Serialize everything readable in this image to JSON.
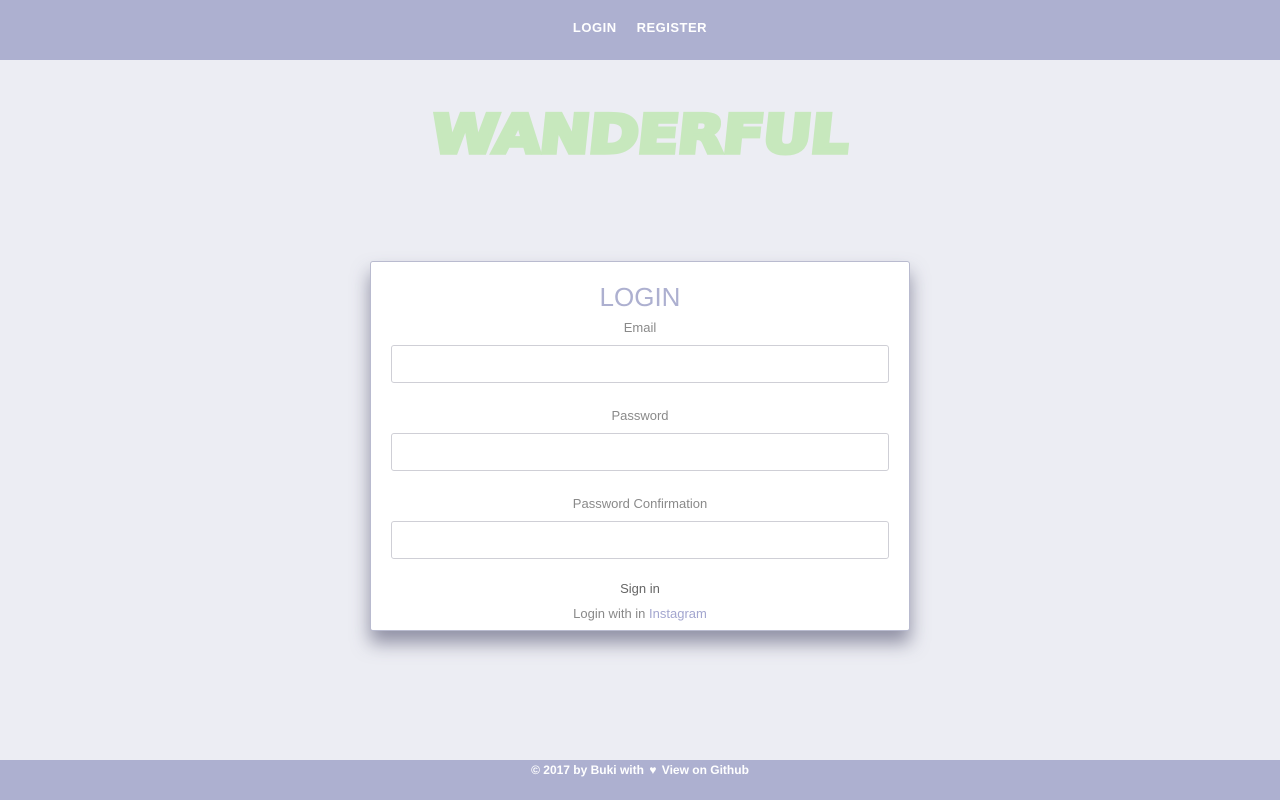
{
  "nav": {
    "login_label": "LOGIN",
    "register_label": "REGISTER"
  },
  "logo": {
    "text": "WANDERFUL",
    "color": "#c7e8bd"
  },
  "login_form": {
    "title": "LOGIN",
    "email_label": "Email",
    "email_value": "",
    "password_label": "Password",
    "password_value": "",
    "password_confirmation_label": "Password Confirmation",
    "password_confirmation_value": "",
    "signin_label": "Sign in",
    "login_with_text": "Login with in",
    "instagram_label": "Instagram"
  },
  "footer": {
    "copyright_text": "© 2017 by Buki with",
    "heart_glyph": "♥",
    "github_link": "View on Github"
  },
  "colors": {
    "nav_bg": "#adb0d0",
    "page_bg": "#ecedf3",
    "accent": "#adb0d0",
    "link": "#a3a6cf"
  },
  "icons": {
    "heart": "heart-icon"
  }
}
